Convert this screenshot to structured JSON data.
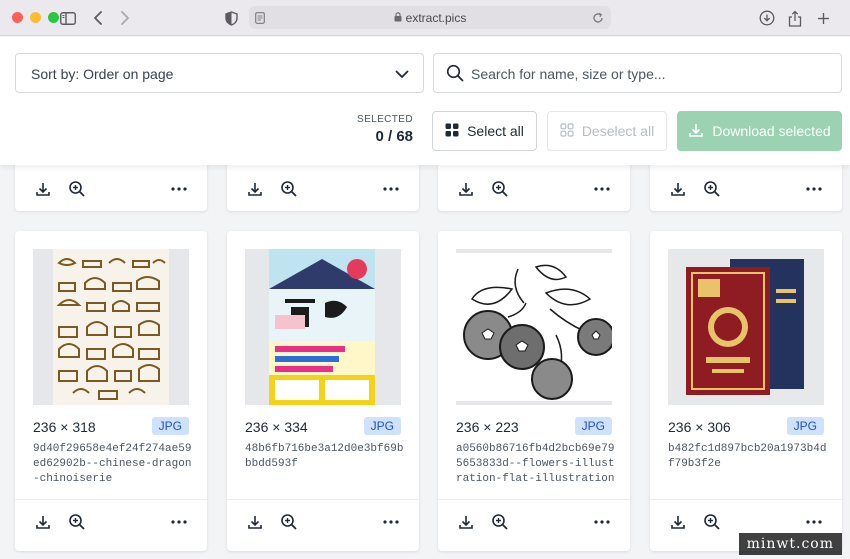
{
  "browser": {
    "url": "extract.pics",
    "icons": [
      "sidebar-icon",
      "back-icon",
      "forward-icon",
      "shield-icon",
      "page-icon",
      "reload-icon",
      "downloads-icon",
      "share-icon",
      "new-tab-icon"
    ]
  },
  "toolbar": {
    "sort_label": "Sort by: Order on page",
    "search_placeholder": "Search for name, size or type...",
    "selected_label": "SELECTED",
    "selected_count": "0 / 68",
    "select_all_label": "Select all",
    "deselect_all_label": "Deselect all",
    "download_label": "Download selected",
    "download_color": "#9bd3b2"
  },
  "cards": [
    {
      "dims": "236 × 318",
      "type": "JPG",
      "name": "9d40f29658e4ef24f274ae59ed62902b--chinese-dragon-chinoiserie",
      "thumb": "chinese-ornament-patterns"
    },
    {
      "dims": "236 × 334",
      "type": "JPG",
      "name": "48b6fb716be3a12d0e3bf69bbbdd593f",
      "thumb": "japanese-festival-poster"
    },
    {
      "dims": "236 × 223",
      "type": "JPG",
      "name": "a0560b86716fb4d2bcb69e795653833d--flowers-illustration-flat-illustration",
      "thumb": "berry-branch-engraving"
    },
    {
      "dims": "236 × 306",
      "type": "JPG",
      "name": "b482fc1d897bcb20a1973b4df79b3f2e",
      "thumb": "red-blue-poster-mockup"
    }
  ],
  "watermark": "minwt.com"
}
